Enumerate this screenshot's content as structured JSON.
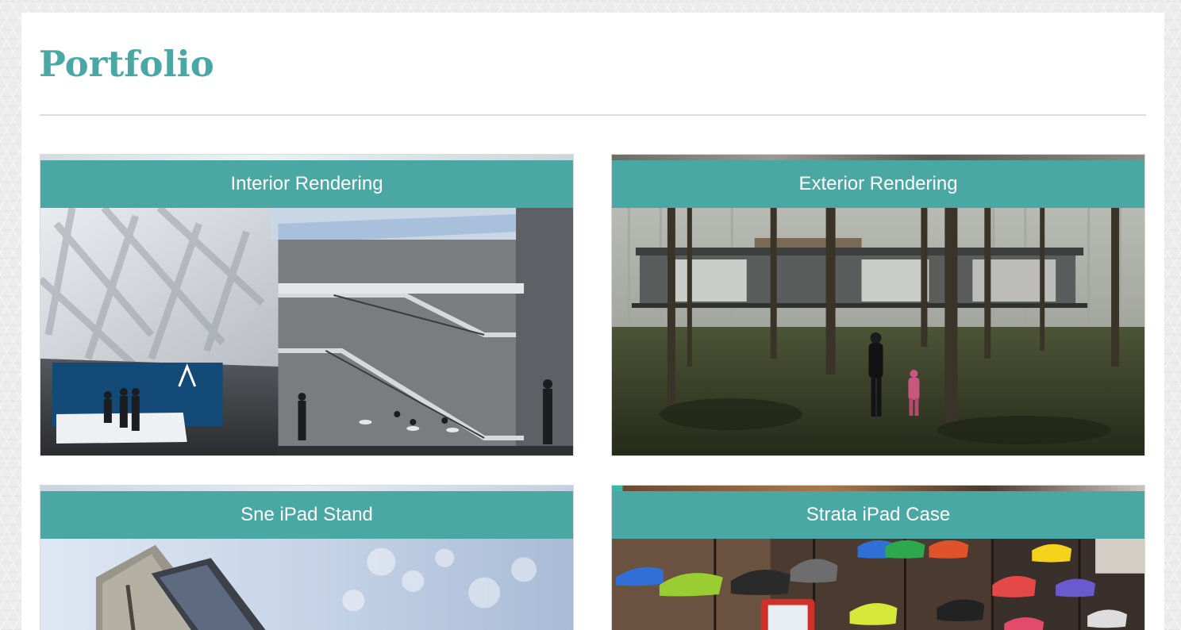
{
  "page": {
    "title": "Portfolio"
  },
  "colors": {
    "accent": "#4aa8a4",
    "divider": "#dcdcdc",
    "page_background": "#ececec"
  },
  "cards": [
    {
      "label": "Interior Rendering",
      "image": "atrium-interior-rendering-photo"
    },
    {
      "label": "Exterior Rendering",
      "image": "forest-house-exterior-rendering-photo"
    },
    {
      "label": "Sne iPad Stand",
      "image": "ipad-stand-product-photo"
    },
    {
      "label": "Strata iPad Case",
      "image": "shoe-store-ipad-case-photo"
    }
  ]
}
